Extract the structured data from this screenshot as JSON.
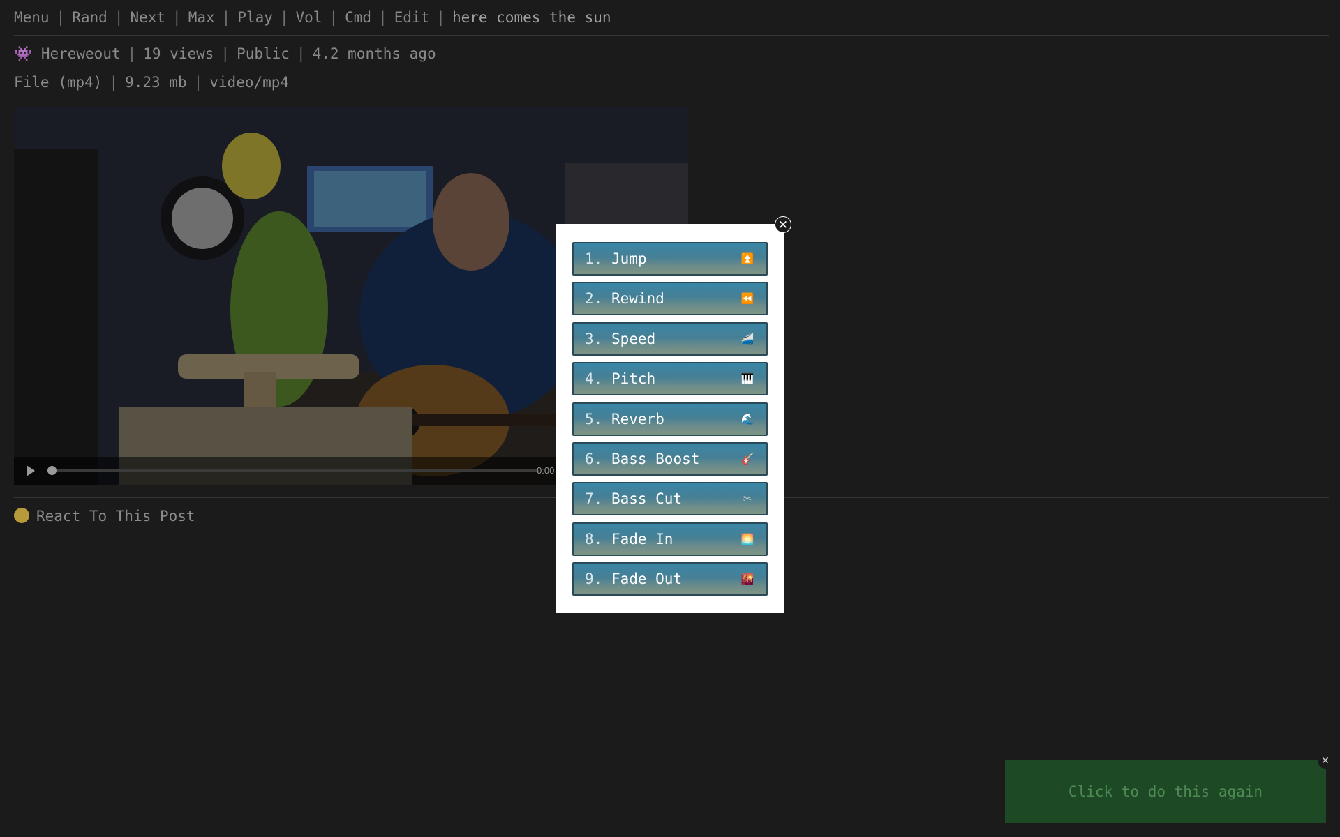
{
  "nav": {
    "items": [
      "Menu",
      "Rand",
      "Next",
      "Max",
      "Play",
      "Vol",
      "Cmd",
      "Edit"
    ],
    "title": "here comes the sun"
  },
  "post_meta": {
    "author_icon": "alien-monster-icon",
    "author": "Hereweout",
    "views": "19 views",
    "visibility": "Public",
    "age": "4.2 months ago"
  },
  "file_meta": {
    "file_type": "File (mp4)",
    "size": "9.23 mb",
    "mime": "video/mp4"
  },
  "video": {
    "time": "0:00",
    "progress": 0
  },
  "react": {
    "icon": "hugging-face-icon",
    "label": "React To This Post"
  },
  "modal": {
    "close_icon": "close-icon",
    "items": [
      {
        "number": "1.",
        "label": "Jump",
        "icon": "up-arrow-icon",
        "glyph": "⏫",
        "icon_color": "#f08a1c"
      },
      {
        "number": "2.",
        "label": "Rewind",
        "icon": "rewind-icon",
        "glyph": "⏪",
        "icon_color": "#f08a1c"
      },
      {
        "number": "3.",
        "label": "Speed",
        "icon": "bullet-train-icon",
        "glyph": "🚄",
        "icon_color": "#dfe6ea"
      },
      {
        "number": "4.",
        "label": "Pitch",
        "icon": "piano-keys-icon",
        "glyph": "🎹",
        "icon_color": "#202020"
      },
      {
        "number": "5.",
        "label": "Reverb",
        "icon": "wave-icon",
        "glyph": "🌊",
        "icon_color": "#2f7fd0"
      },
      {
        "number": "6.",
        "label": "Bass Boost",
        "icon": "guitar-icon",
        "glyph": "🎸",
        "icon_color": "#d65a2a"
      },
      {
        "number": "7.",
        "label": "Bass Cut",
        "icon": "scissors-icon",
        "glyph": "✂",
        "icon_color": "#c8c8c8"
      },
      {
        "number": "8.",
        "label": "Fade In",
        "icon": "sunrise-icon",
        "glyph": "🌅",
        "icon_color": "#f2b640"
      },
      {
        "number": "9.",
        "label": "Fade Out",
        "icon": "sunset-city-icon",
        "glyph": "🌇",
        "icon_color": "#c2456a"
      }
    ]
  },
  "toast": {
    "label": "Click to do this again",
    "close_icon": "close-icon"
  },
  "colors": {
    "background": "#1b1b1b",
    "button_gradient_top": "#3a86a6",
    "button_gradient_bottom": "#7d9584",
    "toast_background": "#1d4a24",
    "toast_text": "#4f8a55"
  }
}
